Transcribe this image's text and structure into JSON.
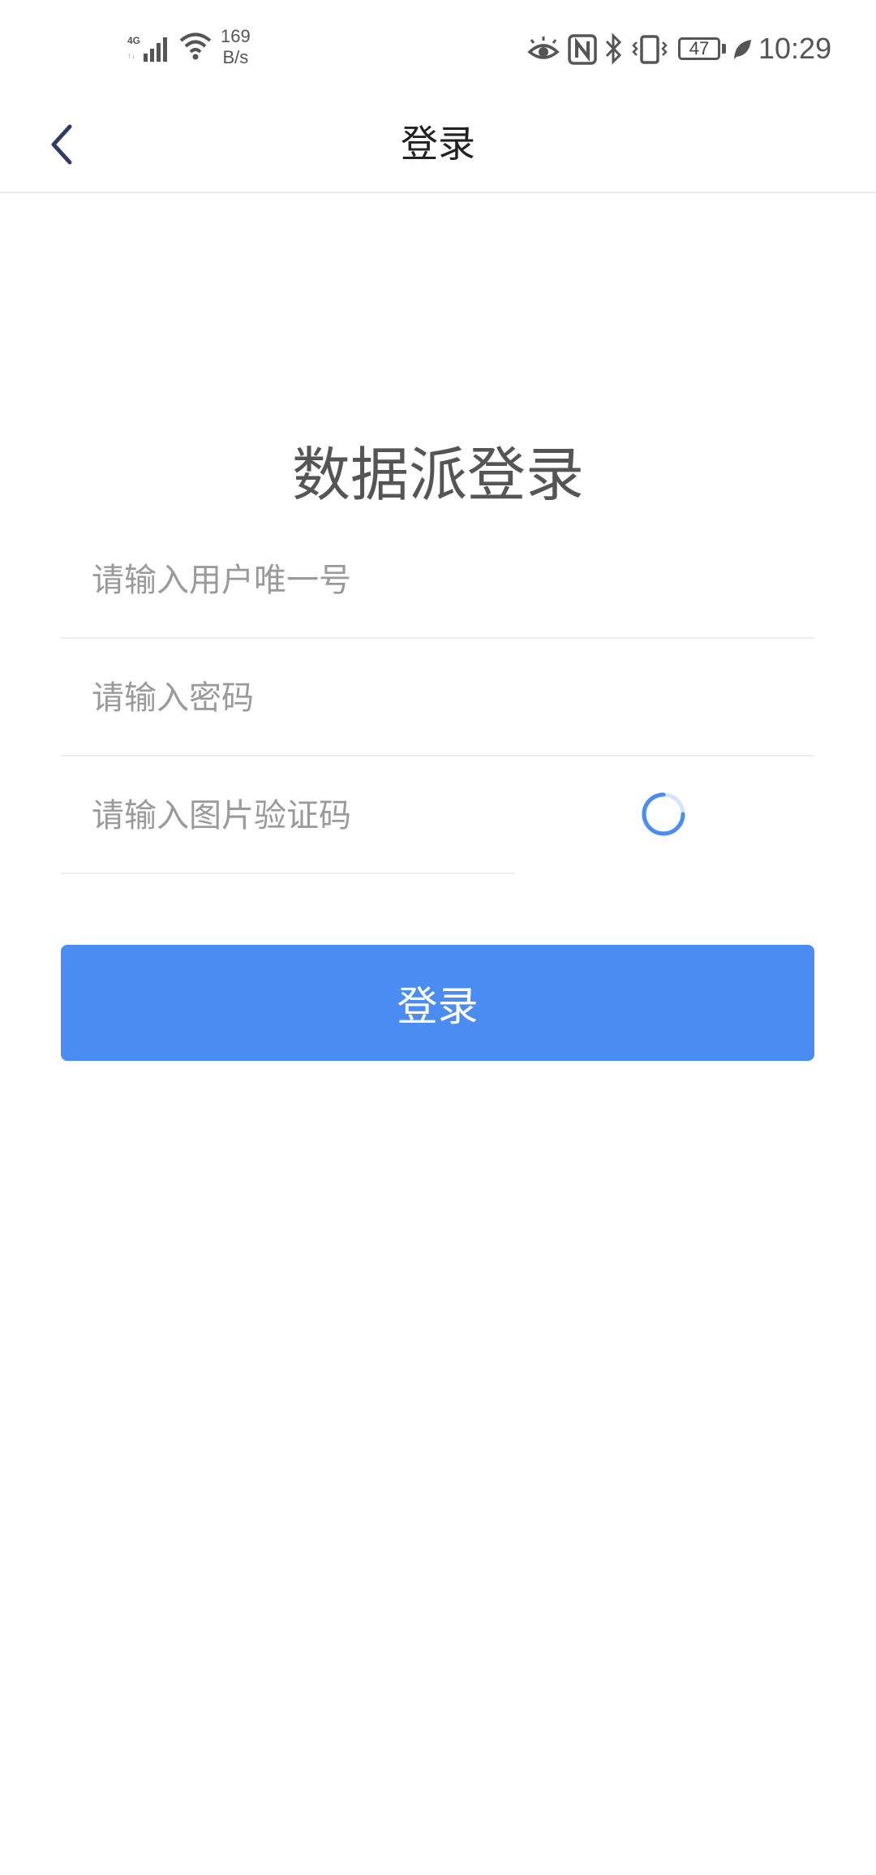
{
  "status_bar": {
    "network_type": "4G",
    "speed_value": "169",
    "speed_unit": "B/s",
    "battery_level": "47",
    "time": "10:29",
    "icons": [
      "signal-icon",
      "wifi-icon",
      "eye-comfort-icon",
      "nfc-icon",
      "bluetooth-icon",
      "vibrate-icon",
      "battery-icon",
      "power-saving-leaf-icon"
    ]
  },
  "nav": {
    "title": "登录",
    "back_icon": "chevron-left-icon"
  },
  "form": {
    "heading": "数据派登录",
    "username_placeholder": "请输入用户唯一号",
    "username_value": "",
    "password_placeholder": "请输入密码",
    "password_value": "",
    "captcha_placeholder": "请输入图片验证码",
    "captcha_value": "",
    "captcha_image_icon": "loading-spinner-icon",
    "login_label": "登录"
  },
  "colors": {
    "primary_button": "#4a8cf1",
    "spinner": "#4a8cf1",
    "back_icon": "#2f3a66",
    "divider": "#ededed"
  }
}
